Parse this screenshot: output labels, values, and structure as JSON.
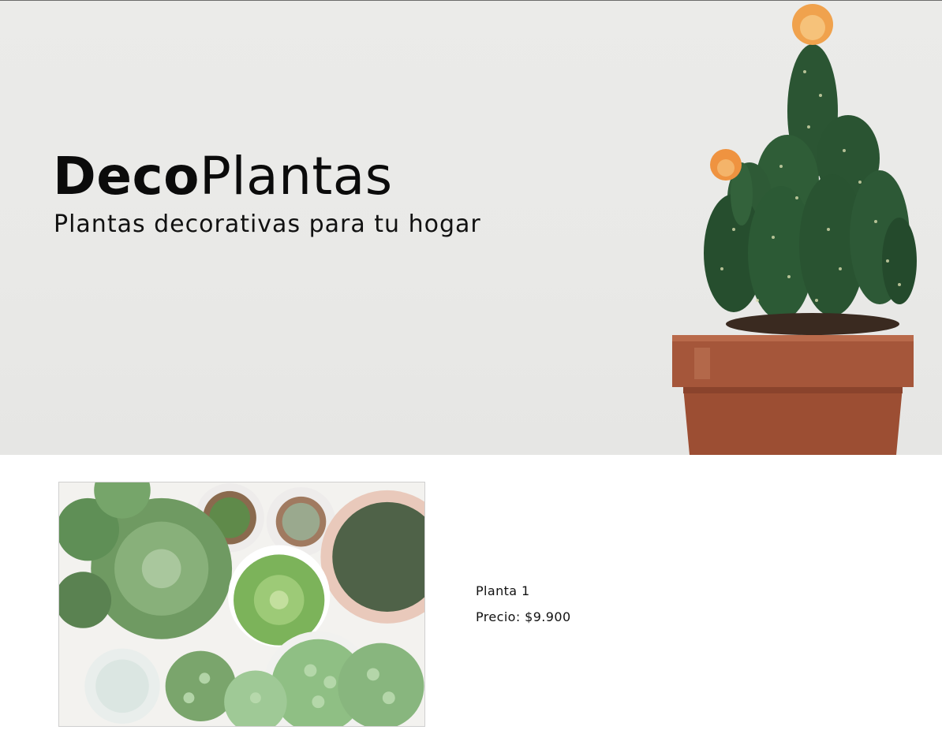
{
  "hero": {
    "brand_bold": "Deco",
    "brand_rest": "Plantas",
    "tagline": "Plantas decorativas para tu hogar"
  },
  "product": {
    "name": "Planta 1",
    "price": "Precio: $9.900"
  },
  "colors": {
    "hero_bg": "#eaeae8",
    "pot": "#a8583a",
    "cactus": "#2f5a35",
    "flower": "#f0a050"
  }
}
